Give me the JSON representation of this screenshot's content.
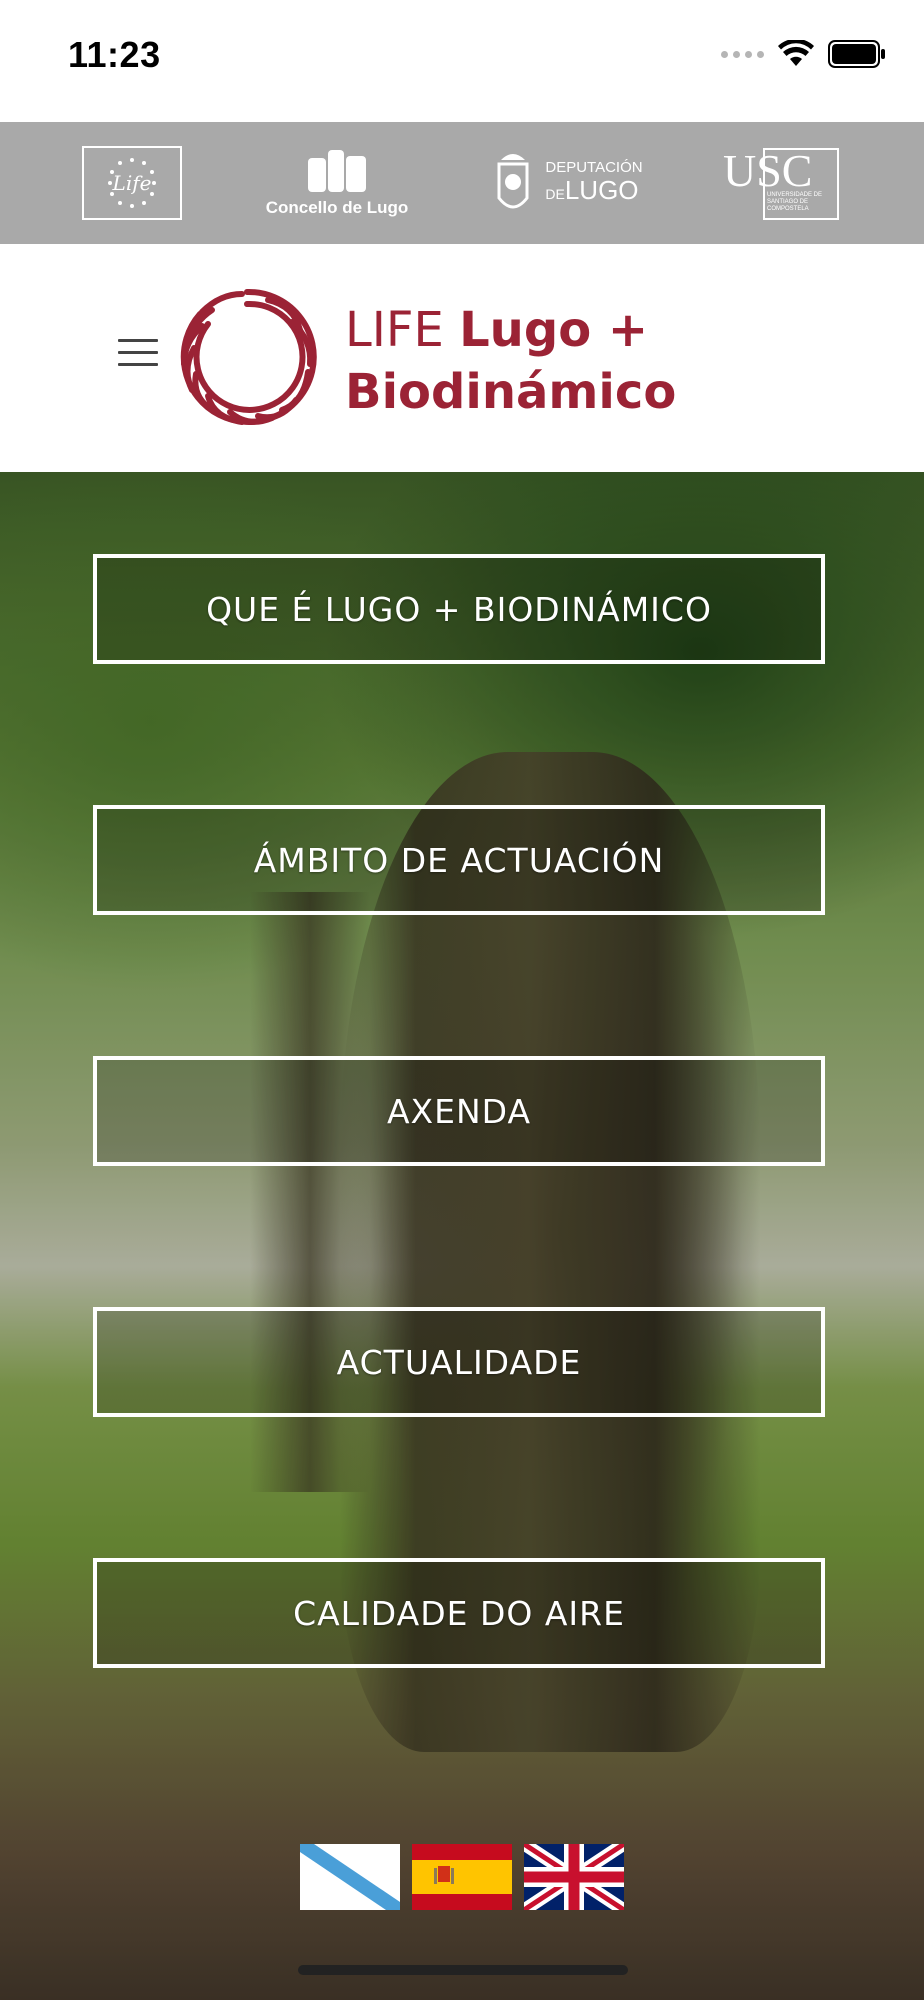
{
  "status_bar": {
    "time": "11:23",
    "icons": [
      "signal-dots-icon",
      "wifi-icon",
      "battery-icon"
    ]
  },
  "partners": [
    {
      "name": "life-eu-logo",
      "label": "Life"
    },
    {
      "name": "concello-de-lugo-logo",
      "label": "Concello de Lugo"
    },
    {
      "name": "deputacion-de-lugo-logo",
      "label_top": "DEPUTACIÓN",
      "label_de": "DE",
      "label_main": "LUGO"
    },
    {
      "name": "usc-logo",
      "label": "USC",
      "sub": "UNIVERSIDADE DE SANTIAGO DE COMPOSTELA"
    }
  ],
  "header": {
    "menu_icon": "hamburger-menu-icon",
    "brand_line1_light": "LIFE ",
    "brand_line1_bold": "Lugo +",
    "brand_line2": "Biodinámico",
    "brand_color": "#9b2335"
  },
  "menu": {
    "items": [
      {
        "label": "QUE É LUGO + BIODINÁMICO"
      },
      {
        "label": "ÁMBITO DE ACTUACIÓN"
      },
      {
        "label": "AXENDA"
      },
      {
        "label": "ACTUALIDADE"
      },
      {
        "label": "CALIDADE DO AIRE"
      }
    ]
  },
  "languages": [
    {
      "name": "galician-flag",
      "lang": "gl"
    },
    {
      "name": "spanish-flag",
      "lang": "es"
    },
    {
      "name": "uk-flag",
      "lang": "en"
    }
  ],
  "colors": {
    "partner_bar": "#a9a9a9",
    "menu_border": "#ffffff"
  }
}
